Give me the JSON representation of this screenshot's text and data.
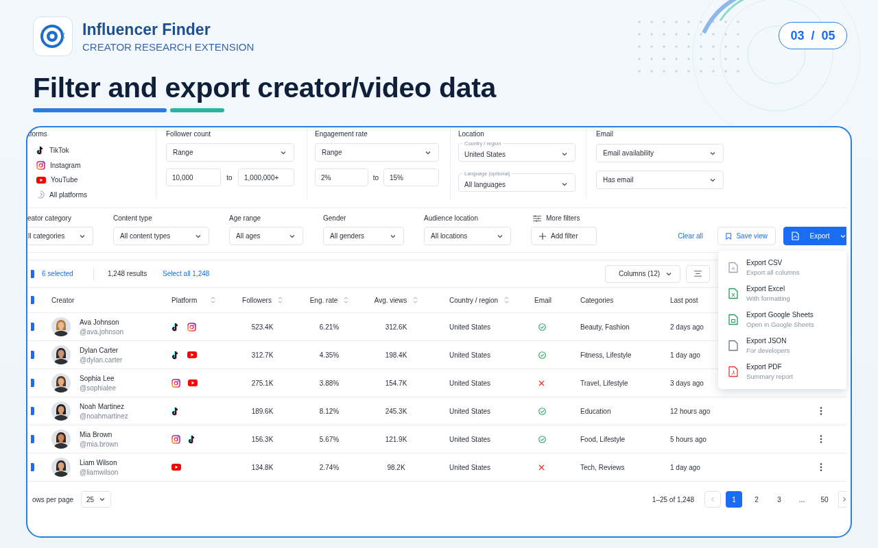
{
  "app": {
    "name": "Influencer Finder",
    "subtitle": "CREATOR RESEARCH EXTENSION"
  },
  "page_indicator": "03  /  05",
  "heading": "Filter and export creator/video data",
  "filters": {
    "platforms": {
      "label": "tforms",
      "items": [
        {
          "kind": "tiktok",
          "label": "TikTok"
        },
        {
          "kind": "instagram",
          "label": "Instagram"
        },
        {
          "kind": "youtube",
          "label": "YouTube"
        },
        {
          "kind": "all",
          "label": "All platforms"
        }
      ]
    },
    "follower_count": {
      "label": "Follower count",
      "mode": "Range",
      "min": "10,000",
      "separator": "to",
      "max": "1,000,000+"
    },
    "engagement_rate": {
      "label": "Engagement rate",
      "mode": "Range",
      "min": "2%",
      "separator": "to",
      "max": "15%"
    },
    "location": {
      "label": "Location",
      "country": {
        "label": "Country / region",
        "value": "United States"
      },
      "language": {
        "label": "Language (optional)",
        "value": "All languages"
      }
    },
    "email": {
      "label": "Email",
      "availability": "Email availability",
      "value": "Has email"
    }
  },
  "quick_filters": [
    {
      "label": "eator category",
      "value": "ll categories"
    },
    {
      "label": "Content type",
      "value": "All content types"
    },
    {
      "label": "Age range",
      "value": "All ages"
    },
    {
      "label": "Gender",
      "value": "All genders"
    },
    {
      "label": "Audience location",
      "value": "All locations"
    }
  ],
  "more_filters": {
    "label": "More filters",
    "button": "Add filter"
  },
  "actions": {
    "clear": "Clear all",
    "save": "Save view",
    "export": "Export"
  },
  "toolbar": {
    "checked": true,
    "selected": "6 selected",
    "results": "1,248 results",
    "select_all": "Select all 1,248",
    "columns": "Columns (12)"
  },
  "table": {
    "checked": true,
    "columns": [
      {
        "label": "Creator",
        "sortable": false
      },
      {
        "label": "Platform",
        "sortable": true
      },
      {
        "label": "Followers",
        "sortable": true
      },
      {
        "label": "Eng. rate",
        "sortable": true
      },
      {
        "label": "Avg. views",
        "sortable": true
      },
      {
        "label": "Country / region",
        "sortable": true
      },
      {
        "label": "Email",
        "sortable": false
      },
      {
        "label": "Categories",
        "sortable": false
      },
      {
        "label": "Last post",
        "sortable": false
      }
    ],
    "rows": [
      {
        "checked": true,
        "name": "Ava Johnson",
        "handle": "@ava.johnson",
        "platforms": [
          {
            "kind": "tiktok"
          },
          {
            "kind": "instagram"
          }
        ],
        "followers": "523.4K",
        "eng_rate": "6.21%",
        "avg_views": "312.6K",
        "country": "United States",
        "email": true,
        "categories": "Beauty, Fashion",
        "last_post": "2 days ago"
      },
      {
        "checked": true,
        "name": "Dylan Carter",
        "handle": "@dylan.carter",
        "platforms": [
          {
            "kind": "tiktok"
          },
          {
            "kind": "youtube"
          }
        ],
        "followers": "312.7K",
        "eng_rate": "4.35%",
        "avg_views": "198.4K",
        "country": "United States",
        "email": true,
        "categories": "Fitness, Lifestyle",
        "last_post": "1 day ago"
      },
      {
        "checked": true,
        "name": "Sophia Lee",
        "handle": "@sophialee",
        "platforms": [
          {
            "kind": "instagram"
          },
          {
            "kind": "youtube"
          }
        ],
        "followers": "275.1K",
        "eng_rate": "3.88%",
        "avg_views": "154.7K",
        "country": "United States",
        "email": false,
        "categories": "Travel, Lifestyle",
        "last_post": "3 days ago"
      },
      {
        "checked": true,
        "name": "Noah Martinez",
        "handle": "@noahmartinez",
        "platforms": [
          {
            "kind": "tiktok"
          }
        ],
        "followers": "189.6K",
        "eng_rate": "8.12%",
        "avg_views": "245.3K",
        "country": "United States",
        "email": true,
        "categories": "Education",
        "last_post": "12 hours ago"
      },
      {
        "checked": true,
        "name": "Mia Brown",
        "handle": "@mia.brown",
        "platforms": [
          {
            "kind": "instagram"
          },
          {
            "kind": "tiktok"
          }
        ],
        "followers": "156.3K",
        "eng_rate": "5.67%",
        "avg_views": "121.9K",
        "country": "United States",
        "email": true,
        "categories": "Food, Lifestyle",
        "last_post": "5 hours ago"
      },
      {
        "checked": true,
        "name": "Liam Wilson",
        "handle": "@liamwilson",
        "platforms": [
          {
            "kind": "youtube"
          }
        ],
        "followers": "134.8K",
        "eng_rate": "2.74%",
        "avg_views": "98.2K",
        "country": "United States",
        "email": false,
        "categories": "Tech, Reviews",
        "last_post": "1 day ago"
      }
    ]
  },
  "export_menu": [
    {
      "kind": "csv",
      "label": "Export CSV",
      "description": "Export all columns"
    },
    {
      "kind": "excel",
      "label": "Export Excel",
      "description": "With formatting"
    },
    {
      "kind": "sheets",
      "label": "Export Google Sheets",
      "description": "Open in Google Sheets"
    },
    {
      "kind": "json",
      "label": "Export JSON",
      "description": "For developers"
    },
    {
      "kind": "pdf",
      "label": "Export PDF",
      "description": "Summary report"
    }
  ],
  "pagination": {
    "rows_label": "ows per page",
    "rows_value": "25",
    "range": "1–25 of 1,248",
    "pages": [
      {
        "label": "1",
        "selected": true
      },
      {
        "label": "2",
        "selected": false
      },
      {
        "label": "3",
        "selected": false
      },
      {
        "label": "...",
        "selected": false
      },
      {
        "label": "50",
        "selected": false
      }
    ]
  }
}
